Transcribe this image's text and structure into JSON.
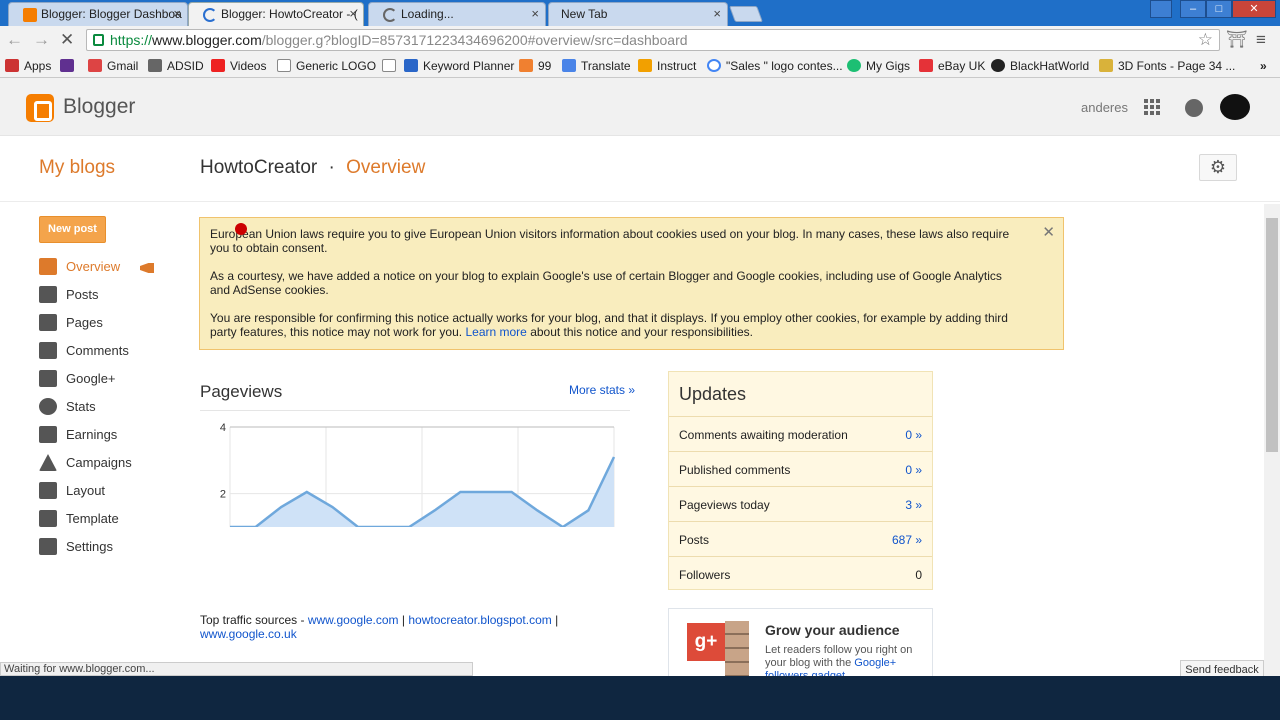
{
  "browser": {
    "tabs": [
      {
        "title": "Blogger: Blogger Dashboa",
        "close": "×"
      },
      {
        "title": "Blogger: HowtoCreator - (",
        "close": "×"
      },
      {
        "title": "Loading...",
        "close": "×"
      },
      {
        "title": "New Tab",
        "close": "×"
      }
    ],
    "url_scheme": "https://",
    "url_host": "www.blogger.com",
    "url_path": "/blogger.g?blogID=8573171223434696200#overview/src=dashboard",
    "bookmarks": [
      "Apps",
      "Gmail",
      "ADSID",
      "Videos",
      "Generic LOGO",
      "Keyword Planner",
      "99",
      "Translate",
      "Instruct",
      "\"Sales \" logo contes...",
      "My Gigs",
      "eBay UK",
      "BlackHatWorld",
      "3D Fonts - Page 34 ..."
    ],
    "status_text": "Waiting for www.blogger.com..."
  },
  "header": {
    "logo_text": "Blogger",
    "username": "anderes"
  },
  "page": {
    "my_blogs": "My blogs",
    "blog_name": "HowtoCreator",
    "separator": "·",
    "section": "Overview"
  },
  "sidebar": {
    "new_post": "New post",
    "items": [
      {
        "label": "Overview",
        "icon": "home-icon"
      },
      {
        "label": "Posts",
        "icon": "posts-icon"
      },
      {
        "label": "Pages",
        "icon": "pages-icon"
      },
      {
        "label": "Comments",
        "icon": "comment-icon"
      },
      {
        "label": "Google+",
        "icon": "gplus-icon"
      },
      {
        "label": "Stats",
        "icon": "pie-chart-icon"
      },
      {
        "label": "Earnings",
        "icon": "trophy-icon"
      },
      {
        "label": "Campaigns",
        "icon": "campaigns-icon"
      },
      {
        "label": "Layout",
        "icon": "layout-icon"
      },
      {
        "label": "Template",
        "icon": "template-icon"
      },
      {
        "label": "Settings",
        "icon": "wrench-icon"
      }
    ]
  },
  "cookie_notice": {
    "p1": "European Union laws require you to give European Union visitors information about cookies used on your blog. In many cases, these laws also require you to obtain consent.",
    "p2": "As a courtesy, we have added a notice on your blog to explain Google's use of certain Blogger and Google cookies, including use of Google Analytics and AdSense cookies.",
    "p3_before": "You are responsible for confirming this notice actually works for your blog, and that it displays. If you employ other cookies, for example by adding third party features, this notice may not work for you.",
    "p3_link": "Learn more",
    "p3_after": "about this notice and your responsibilities."
  },
  "pageviews": {
    "title": "Pageviews",
    "more_stats": "More stats »",
    "traffic_label": "Top traffic sources -",
    "traffic_sources": [
      "www.google.com",
      "howtocreator.blogspot.com",
      "www.google.co.uk"
    ],
    "traffic_sep": "|"
  },
  "chart_data": {
    "type": "area",
    "title": "",
    "xlabel": "",
    "ylabel": "",
    "ylim": [
      1,
      4
    ],
    "yticks": [
      2,
      4
    ],
    "x": [
      0,
      1,
      2,
      3,
      4,
      5,
      6,
      7,
      8,
      9,
      10,
      11,
      12,
      13,
      14,
      15
    ],
    "values": [
      1,
      1,
      1.6,
      2.05,
      1.6,
      1,
      1,
      1,
      1.5,
      2.05,
      2.05,
      2.05,
      1.5,
      1,
      1.5,
      3.1
    ],
    "grid": true,
    "color": "#6fa8dc"
  },
  "updates": {
    "title": "Updates",
    "rows": [
      {
        "label": "Comments awaiting moderation",
        "value": "0 »"
      },
      {
        "label": "Published comments",
        "value": "0 »"
      },
      {
        "label": "Pageviews today",
        "value": "3 »"
      },
      {
        "label": "Posts",
        "value": "687 »"
      },
      {
        "label": "Followers",
        "value": "0"
      }
    ]
  },
  "grow": {
    "logo": "g+",
    "title": "Grow your audience",
    "text": "Let readers follow you right on your blog with the",
    "link": "Google+ followers gadget"
  },
  "feedback": "Send feedback",
  "colors": {
    "accent": "#dd7a2b",
    "link": "#1155cc",
    "notice_bg": "#f9edbe",
    "tabstrip": "#1f6fc8"
  }
}
